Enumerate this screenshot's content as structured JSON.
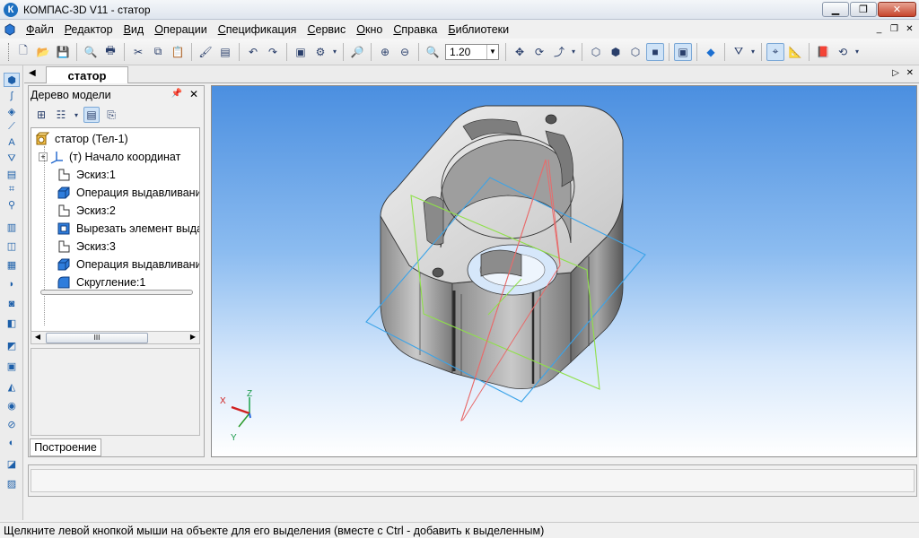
{
  "window": {
    "title": "КОМПАС-3D V11 - статор"
  },
  "menu": {
    "items": [
      {
        "underline": "Ф",
        "rest": "айл"
      },
      {
        "underline": "Р",
        "rest": "едактор"
      },
      {
        "underline": "В",
        "rest": "ид"
      },
      {
        "underline": "О",
        "rest": "перации"
      },
      {
        "underline": "С",
        "rest": "пецификация"
      },
      {
        "underline": "С",
        "rest": "ервис"
      },
      {
        "underline": "О",
        "rest": "кно"
      },
      {
        "underline": "С",
        "rest": "правка"
      },
      {
        "underline": "Б",
        "rest": "иблиотеки"
      }
    ]
  },
  "toolbar": {
    "zoom_value": "1.20"
  },
  "document": {
    "tab_label": "статор"
  },
  "tree": {
    "title": "Дерево модели",
    "root": "статор (Тел-1)",
    "items": [
      "(т) Начало координат",
      "Эскиз:1",
      "Операция выдавливания",
      "Эскиз:2",
      "Вырезать элемент выдав",
      "Эскиз:3",
      "Операция выдавливания",
      "Скругление:1"
    ],
    "scroll_grip": "III",
    "tab_label": "Построение"
  },
  "axes": {
    "x": "X",
    "y": "Y",
    "z": "Z"
  },
  "status": {
    "text": "Щелкните левой кнопкой мыши на объекте для его выделения (вместе с Ctrl - добавить к выделенным)"
  },
  "colors": {
    "viewport_top": "#4b8fe0",
    "viewport_bottom": "#ffffff",
    "plane_xy": "#3ba3e8",
    "plane_zx": "#8fe04a",
    "plane_zy": "#e86b6b"
  }
}
